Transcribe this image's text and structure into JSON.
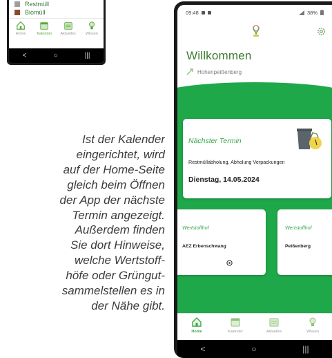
{
  "small_phone": {
    "legend": [
      {
        "label": "Restmüll",
        "color": "#9e9e9e"
      },
      {
        "label": "Biomüll",
        "color": "#8b4a2b"
      }
    ],
    "nav": [
      {
        "label": "Home",
        "icon": "home-icon",
        "active": false
      },
      {
        "label": "Kalender",
        "icon": "calendar-icon",
        "active": true
      },
      {
        "label": "Aktuelles",
        "icon": "news-icon",
        "active": false
      },
      {
        "label": "Wissen",
        "icon": "knowledge-icon",
        "active": false
      }
    ],
    "system_nav": [
      "<",
      "○",
      "|||"
    ]
  },
  "caption": {
    "lines": [
      "Ist der Kalender",
      "eingerichtet, wird",
      "auf der Home-Seite",
      "gleich beim Öffnen",
      "der App der nächste",
      "Termin angezeigt.",
      "Außerdem finden",
      "Sie dort Hinweise,",
      "welche Wertstoff-",
      "höfe oder Grüngut-",
      "sammelstellen es in",
      "der Nähe gibt."
    ]
  },
  "phone": {
    "status": {
      "time": "09:48",
      "battery": "38%"
    },
    "title": "Willkommen",
    "location": "Hohenpeißenberg",
    "next_appointment": {
      "title": "Nächster Termin",
      "description": "Restmüllabholung, Abholung Verpackungen",
      "date": "Dienstag, 14.05.2024"
    },
    "recycling_centers": [
      {
        "label": "Wertstoffhof",
        "name": "AEZ Erbenschwang"
      },
      {
        "label": "Wertstoffhof",
        "name": "Peißenberg"
      }
    ],
    "nav": [
      {
        "label": "Home",
        "icon": "home-icon",
        "active": true
      },
      {
        "label": "Kalender",
        "icon": "calendar-icon",
        "active": false
      },
      {
        "label": "Aktuelles",
        "icon": "news-icon",
        "active": false
      },
      {
        "label": "Wissen",
        "icon": "knowledge-icon",
        "active": false
      }
    ],
    "system_nav": [
      "<",
      "○",
      "|||"
    ],
    "colors": {
      "accent": "#3aa848",
      "green_bg": "#1fa84a",
      "title": "#3c7a2e"
    }
  }
}
